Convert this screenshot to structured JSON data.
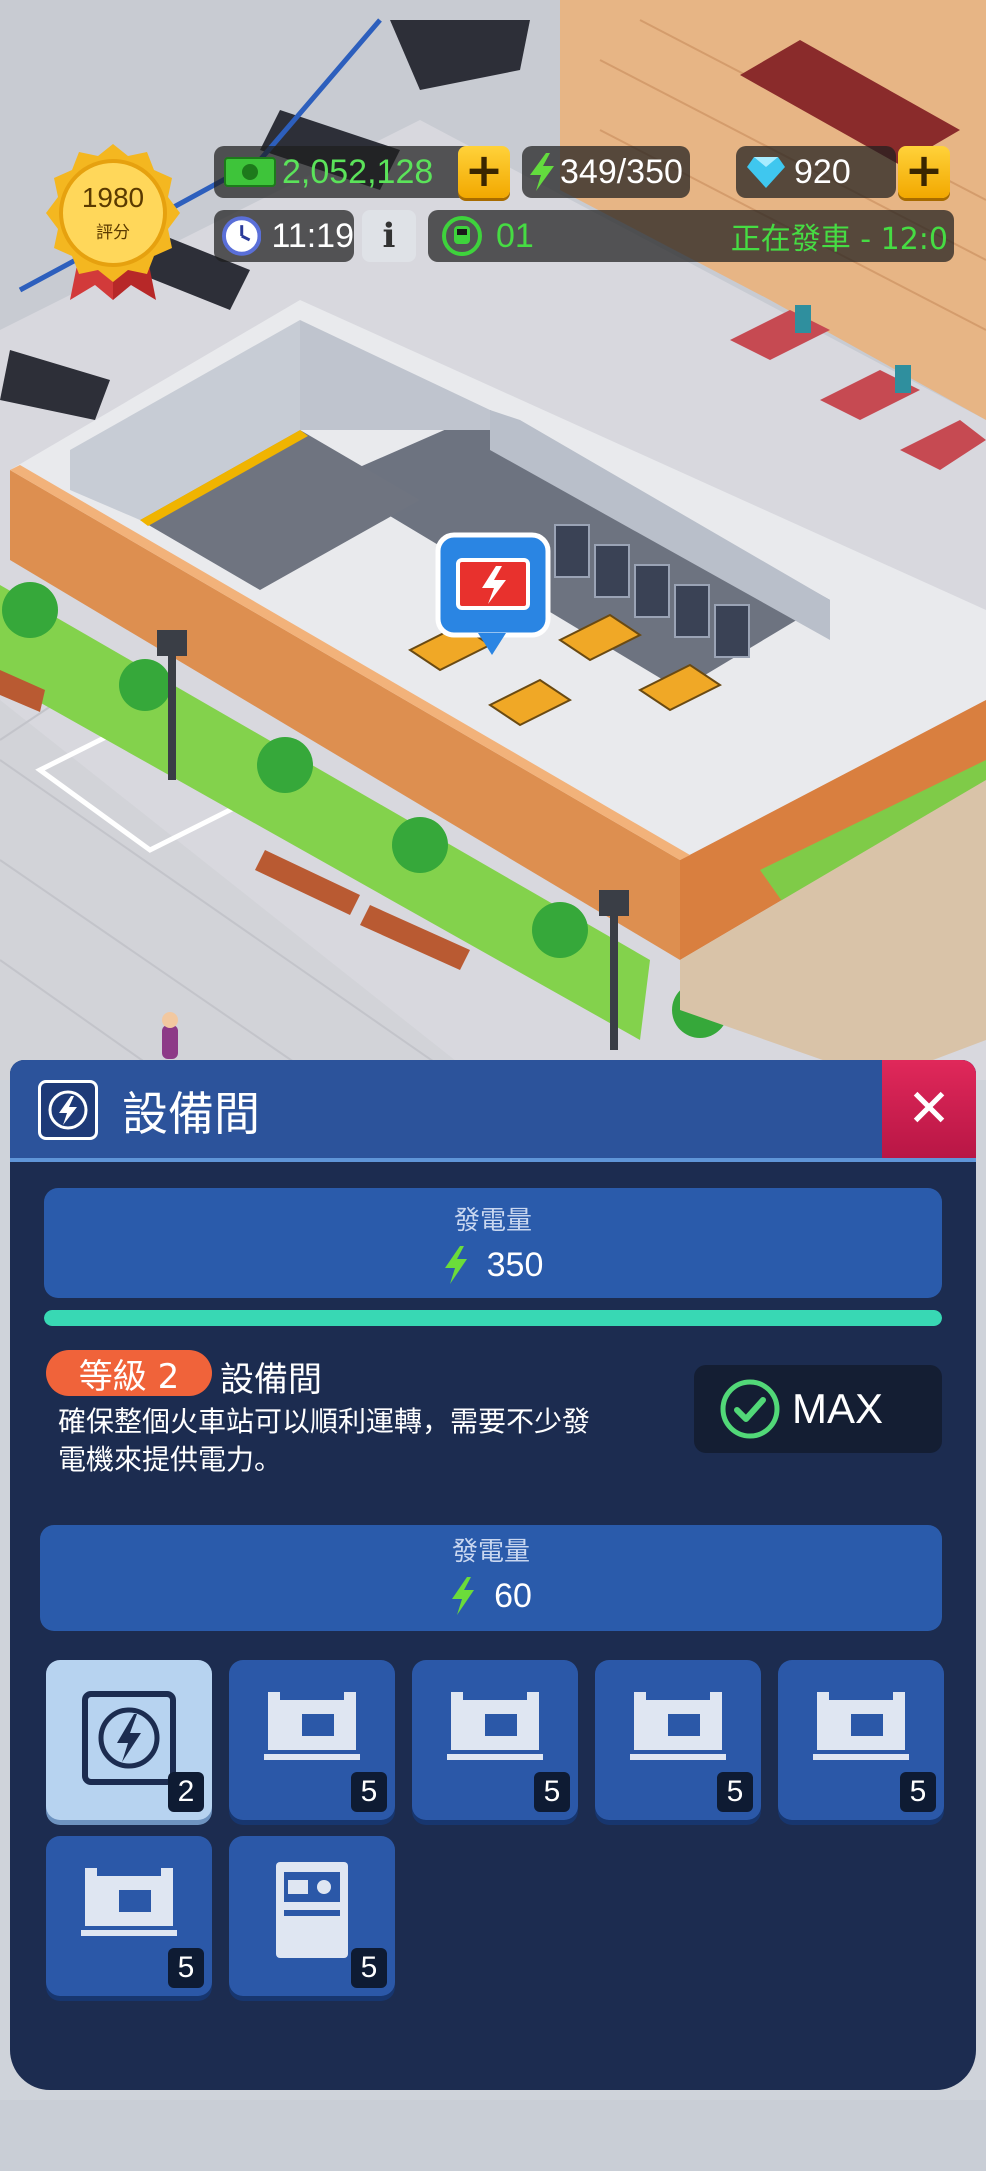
{
  "hud": {
    "rating_value": "1980",
    "rating_label": "評分",
    "cash": "2,052,128",
    "energy": "349/350",
    "gems": "920",
    "clock": "11:19",
    "info": "i",
    "train_number": "01",
    "status": "正在發車 - 12:0"
  },
  "panel": {
    "title": "設備間",
    "close": "✕",
    "total_output_label": "發電量",
    "total_output_value": "350",
    "progress": 1.0,
    "level_badge": "等級 2",
    "room_name": "設備間",
    "description_line1": "確保整個火車站可以順利運轉，需要不少發",
    "description_line2": "電機來提供電力。",
    "max_label": "MAX",
    "item_output_label": "發電量",
    "item_output_value": "60",
    "tiles": [
      {
        "icon": "lightning-tile-icon",
        "count": "2"
      },
      {
        "icon": "generator-icon",
        "count": "5"
      },
      {
        "icon": "generator-icon",
        "count": "5"
      },
      {
        "icon": "generator-icon",
        "count": "5"
      },
      {
        "icon": "generator-icon",
        "count": "5"
      },
      {
        "icon": "generator-icon",
        "count": "5"
      },
      {
        "icon": "control-cabinet-icon",
        "count": "5"
      }
    ]
  },
  "colors": {
    "panel_bg": "#1c2c50",
    "header_bg": "#2c539b",
    "accent_green": "#38d8b4",
    "level_orange": "#f0633a",
    "close_red": "#d01f50",
    "cash_green": "#49d24a",
    "coin_gold": "#f2b400"
  }
}
